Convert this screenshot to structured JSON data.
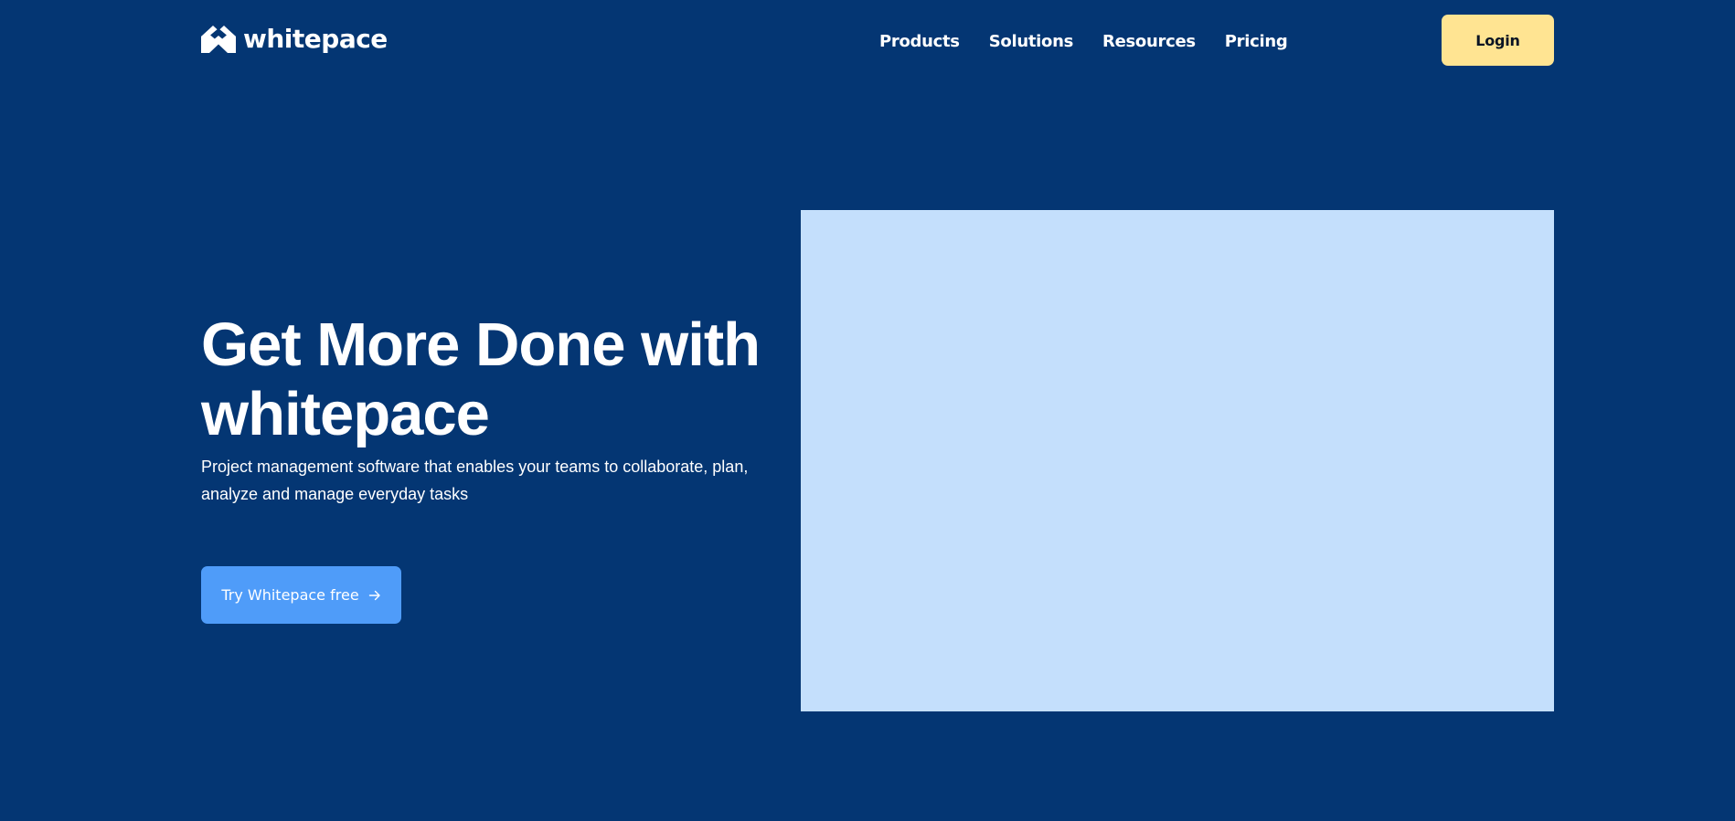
{
  "brand": {
    "name": "whitepace",
    "logo_icon": "chevron-up-logo-icon"
  },
  "nav": {
    "items": [
      {
        "label": "Products"
      },
      {
        "label": "Solutions"
      },
      {
        "label": "Resources"
      },
      {
        "label": "Pricing"
      }
    ],
    "login_label": "Login"
  },
  "hero": {
    "title": "Get More Done with whitepace",
    "subtitle": "Project management software that enables your teams to collaborate, plan, analyze and manage everyday tasks",
    "cta_label": "Try Whitepace free",
    "cta_icon": "arrow-right-icon"
  },
  "colors": {
    "background": "#043673",
    "login_button": "#ffe492",
    "cta_button": "#4f9cf9",
    "image_placeholder": "#c4dffc",
    "text": "#ffffff"
  }
}
